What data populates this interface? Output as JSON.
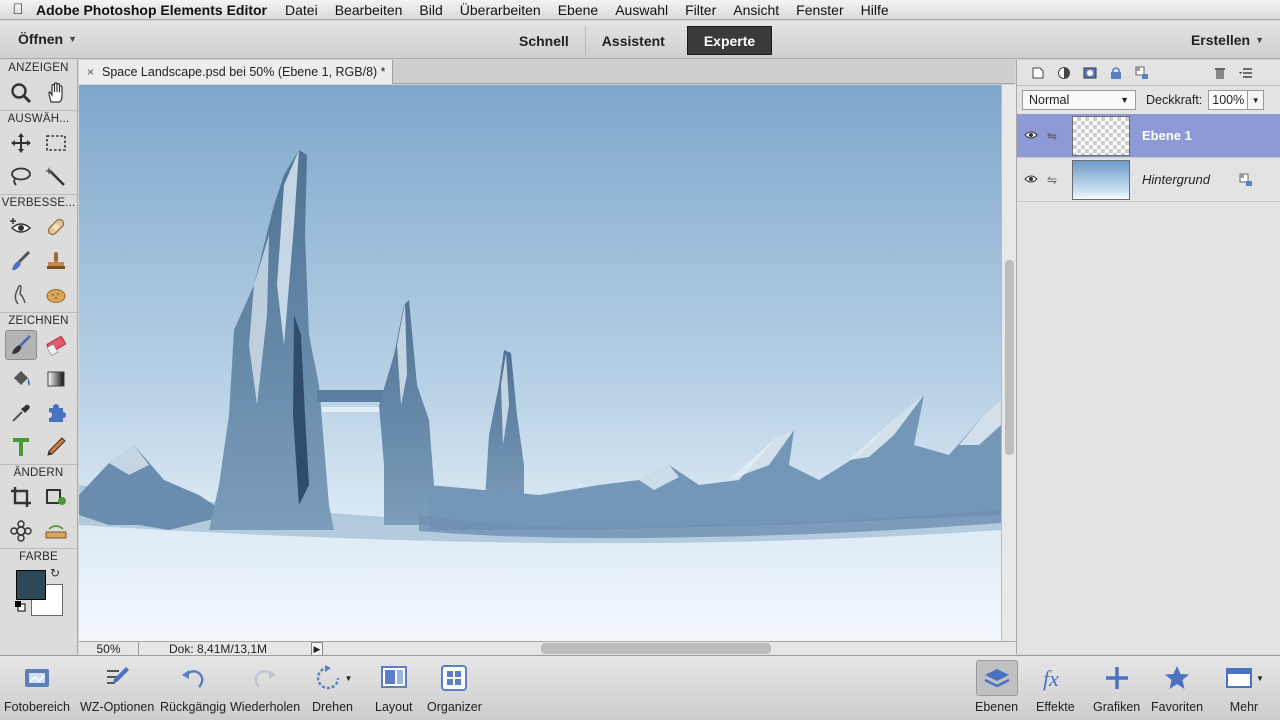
{
  "menubar": {
    "app_name": "Adobe Photoshop Elements Editor",
    "items": [
      "Datei",
      "Bearbeiten",
      "Bild",
      "Überarbeiten",
      "Ebene",
      "Auswahl",
      "Filter",
      "Ansicht",
      "Fenster",
      "Hilfe"
    ]
  },
  "modebar": {
    "open_label": "Öffnen",
    "create_label": "Erstellen",
    "tabs": [
      "Schnell",
      "Assistent",
      "Experte"
    ],
    "active_tab": "Experte"
  },
  "toolbox": {
    "sections": {
      "view": "ANZEIGEN",
      "select": "AUSWÄH...",
      "enhance": "VERBESSE...",
      "draw": "ZEICHNEN",
      "modify": "ÄNDERN",
      "color": "FARBE"
    },
    "foreground_color": "#2d4858",
    "background_color": "#ffffff"
  },
  "document": {
    "tab_title": "Space Landscape.psd bei 50% (Ebene 1, RGB/8) *",
    "zoom": "50%",
    "doc_size": "Dok: 8,41M/13,1M"
  },
  "layers": {
    "blend_mode": "Normal",
    "opacity_label": "Deckkraft:",
    "opacity_value": "100%",
    "items": [
      {
        "name": "Ebene 1",
        "selected": true
      },
      {
        "name": "Hintergrund",
        "selected": false
      }
    ]
  },
  "taskbar": {
    "left": [
      "Fotobereich",
      "WZ-Optionen",
      "Rückgängig",
      "Wiederholen",
      "Drehen",
      "Layout",
      "Organizer"
    ],
    "right": [
      "Ebenen",
      "Effekte",
      "Grafiken",
      "Favoriten",
      "Mehr"
    ]
  },
  "colors": {
    "selected_layer": "#8e9ad6",
    "sky_top": "#7ea7cc",
    "sky_bottom": "#eef5fb"
  }
}
